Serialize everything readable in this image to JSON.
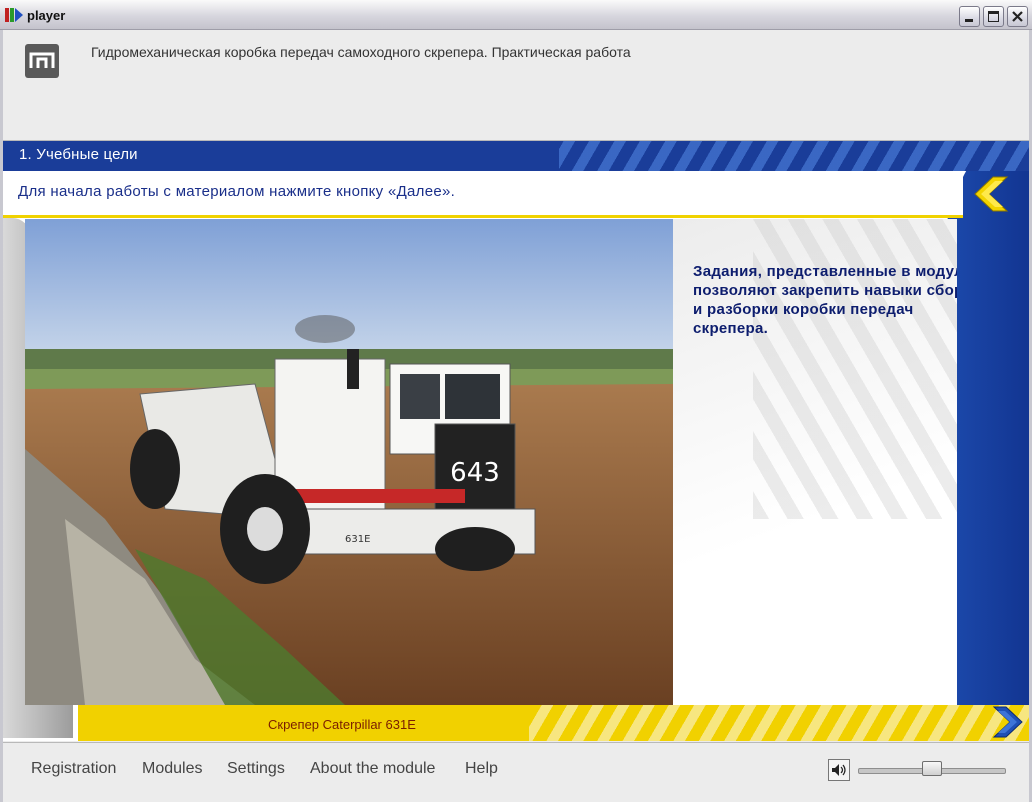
{
  "window": {
    "title": "player"
  },
  "header": {
    "module_title": "Гидромеханическая коробка передач самоходного скрепера. Практическая работа"
  },
  "section": {
    "title": "1. Учебные цели",
    "instruction": "Для начала работы с материалом нажмите кнопку «Далее».",
    "description": "Задания, представленные в модуле, позволяют закрепить навыки сборки и разборки коробки передач скрепера.",
    "photo_caption": "Скрепер Caterpillar 631E",
    "truck_number": "643",
    "truck_model": "631E"
  },
  "footer": {
    "menu": [
      {
        "label": "Registration"
      },
      {
        "label": "Modules"
      },
      {
        "label": "Settings"
      },
      {
        "label": "About the module"
      },
      {
        "label": "Help"
      }
    ],
    "volume_percent": 50
  },
  "colors": {
    "accent_blue": "#1a3d99",
    "accent_yellow": "#f1d100",
    "text_navy": "#0d1d6e"
  }
}
